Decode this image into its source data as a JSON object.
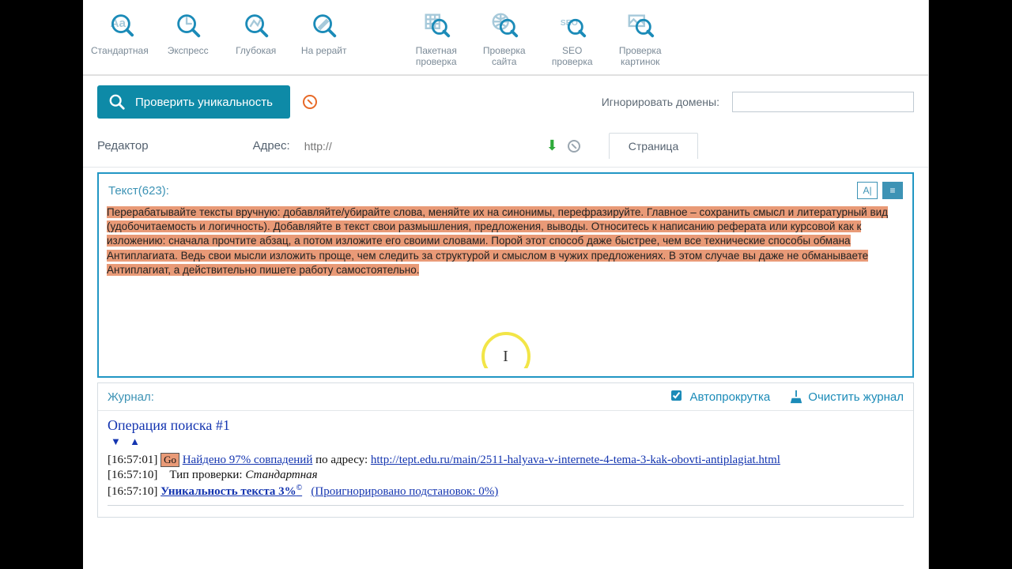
{
  "colors": {
    "accent": "#1b8bb8",
    "highlight": "#e99a77"
  },
  "toolbar": {
    "left": [
      {
        "label": "Стандартная"
      },
      {
        "label": "Экспресс"
      },
      {
        "label": "Глубокая"
      },
      {
        "label": "На рерайт"
      }
    ],
    "right": [
      {
        "label": "Пакетная\nпроверка"
      },
      {
        "label": "Проверка\nсайта"
      },
      {
        "label": "SEO\nпроверка"
      },
      {
        "label": "Проверка\nкартинок"
      }
    ]
  },
  "action": {
    "check_label": "Проверить уникальность",
    "ignore_label": "Игнорировать домены:",
    "ignore_value": ""
  },
  "editor_head": {
    "editor_label": "Редактор",
    "address_label": "Адрес:",
    "address_placeholder": "http://",
    "page_tab": "Страница"
  },
  "editor": {
    "counter_label": "Текст(623):",
    "text": "Перерабатывайте тексты вручную: добавляйте/убирайте слова, меняйте их на синонимы, перефразируйте. Главное – сохранить смысл и литературный вид (удобочитаемость и логичность).\nДобавляйте в текст свои размышления, предложения, выводы. Относитесь к написанию реферата или курсовой как к изложению: сначала прочтите абзац, а потом изложите его своими словами. Порой этот способ даже быстрее, чем все технические способы обмана Антиплагиата. Ведь свои мысли изложить проще, чем следить за структурой и смыслом в чужих предложениях. В этом случае вы даже не обманываете Антиплагиат, а действительно пишете работу самостоятельно."
  },
  "journal": {
    "title": "Журнал:",
    "autoscroll_label": "Автопрокрутка",
    "autoscroll_checked": true,
    "clear_label": "Очистить журнал",
    "operation_title": "Операция поиска #1",
    "lines": [
      {
        "ts": "[16:57:01]",
        "go": "Go",
        "found_text": "Найдено 97% совпадений",
        "at_text": " по адресу: ",
        "url": "http://tept.edu.ru/main/2511-halyava-v-internete-4-tema-3-kak-obovti-antiplagiat.html"
      },
      {
        "ts": "[16:57:10]",
        "type_label": "Тип проверки: ",
        "type_value": "Стандартная"
      },
      {
        "ts": "[16:57:10]",
        "uniq_text": "Уникальность текста 3%",
        "sup": "©",
        "ignored_text": "(Проигнорировано подстановок: 0%)"
      }
    ]
  }
}
